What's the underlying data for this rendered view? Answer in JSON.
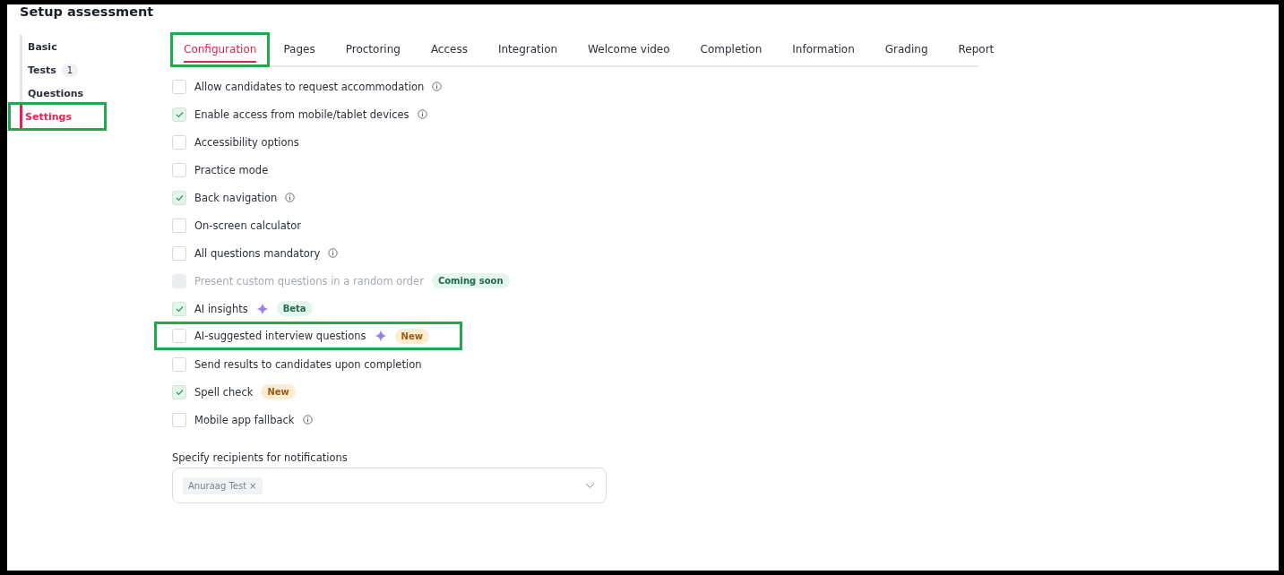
{
  "page": {
    "title": "Setup assessment"
  },
  "sidebar": {
    "items": [
      {
        "label": "Basic",
        "selected": false,
        "highlighted": false
      },
      {
        "label": "Tests",
        "count": "1",
        "selected": false,
        "highlighted": false
      },
      {
        "label": "Questions",
        "selected": false,
        "highlighted": false
      },
      {
        "label": "Settings",
        "selected": true,
        "highlighted": true
      }
    ]
  },
  "tabs": [
    {
      "label": "Configuration",
      "selected": true,
      "highlighted": true
    },
    {
      "label": "Pages",
      "selected": false,
      "highlighted": false
    },
    {
      "label": "Proctoring",
      "selected": false,
      "highlighted": false
    },
    {
      "label": "Access",
      "selected": false,
      "highlighted": false
    },
    {
      "label": "Integration",
      "selected": false,
      "highlighted": false
    },
    {
      "label": "Welcome video",
      "selected": false,
      "highlighted": false
    },
    {
      "label": "Completion",
      "selected": false,
      "highlighted": false
    },
    {
      "label": "Information",
      "selected": false,
      "highlighted": false
    },
    {
      "label": "Grading",
      "selected": false,
      "highlighted": false
    },
    {
      "label": "Report",
      "selected": false,
      "highlighted": false
    }
  ],
  "options": [
    {
      "label": "Allow candidates to request accommodation",
      "checked": false,
      "disabled": false,
      "info": true,
      "ai": false,
      "highlighted": false
    },
    {
      "label": "Enable access from mobile/tablet devices",
      "checked": true,
      "disabled": false,
      "info": true,
      "ai": false,
      "highlighted": false
    },
    {
      "label": "Accessibility options",
      "checked": false,
      "disabled": false,
      "info": false,
      "ai": false,
      "highlighted": false
    },
    {
      "label": "Practice mode",
      "checked": false,
      "disabled": false,
      "info": false,
      "ai": false,
      "highlighted": false
    },
    {
      "label": "Back navigation",
      "checked": true,
      "disabled": false,
      "info": true,
      "ai": false,
      "highlighted": false
    },
    {
      "label": "On-screen calculator",
      "checked": false,
      "disabled": false,
      "info": false,
      "ai": false,
      "highlighted": false
    },
    {
      "label": "All questions mandatory",
      "checked": false,
      "disabled": false,
      "info": true,
      "ai": false,
      "highlighted": false
    },
    {
      "label": "Present custom questions in a random order",
      "checked": false,
      "disabled": true,
      "info": false,
      "ai": false,
      "highlighted": false,
      "badge": {
        "text": "Coming soon",
        "color": "#e3f5ec"
      }
    },
    {
      "label": "AI insights",
      "checked": true,
      "disabled": false,
      "info": false,
      "ai": true,
      "highlighted": false,
      "badge": {
        "text": "Beta",
        "color": "#e3f5ec"
      }
    },
    {
      "label": "AI-suggested interview questions",
      "checked": false,
      "disabled": false,
      "info": false,
      "ai": true,
      "highlighted": true,
      "badge": {
        "text": "New",
        "color": "#fdebd2"
      }
    },
    {
      "label": "Send results to candidates upon completion",
      "checked": false,
      "disabled": false,
      "info": false,
      "ai": false,
      "highlighted": false
    },
    {
      "label": "Spell check",
      "checked": true,
      "disabled": false,
      "info": false,
      "ai": false,
      "highlighted": false,
      "badge": {
        "text": "New",
        "color": "#fdebd2"
      }
    },
    {
      "label": "Mobile app fallback",
      "checked": false,
      "disabled": false,
      "info": true,
      "ai": false,
      "highlighted": false
    }
  ],
  "recipients": {
    "label": "Specify recipients for notifications",
    "chips": [
      {
        "text": "Anuraag Test",
        "remove": "×"
      }
    ]
  }
}
